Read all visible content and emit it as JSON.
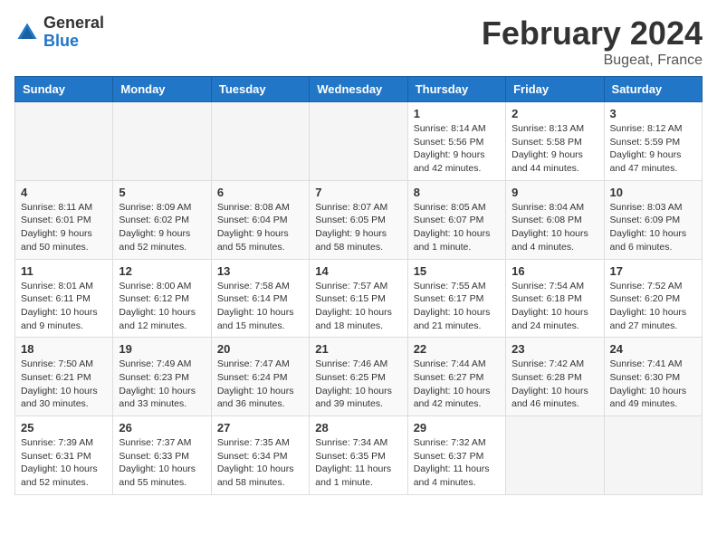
{
  "header": {
    "logo_general": "General",
    "logo_blue": "Blue",
    "month_title": "February 2024",
    "location": "Bugeat, France"
  },
  "weekdays": [
    "Sunday",
    "Monday",
    "Tuesday",
    "Wednesday",
    "Thursday",
    "Friday",
    "Saturday"
  ],
  "weeks": [
    [
      {
        "day": "",
        "info": ""
      },
      {
        "day": "",
        "info": ""
      },
      {
        "day": "",
        "info": ""
      },
      {
        "day": "",
        "info": ""
      },
      {
        "day": "1",
        "info": "Sunrise: 8:14 AM\nSunset: 5:56 PM\nDaylight: 9 hours\nand 42 minutes."
      },
      {
        "day": "2",
        "info": "Sunrise: 8:13 AM\nSunset: 5:58 PM\nDaylight: 9 hours\nand 44 minutes."
      },
      {
        "day": "3",
        "info": "Sunrise: 8:12 AM\nSunset: 5:59 PM\nDaylight: 9 hours\nand 47 minutes."
      }
    ],
    [
      {
        "day": "4",
        "info": "Sunrise: 8:11 AM\nSunset: 6:01 PM\nDaylight: 9 hours\nand 50 minutes."
      },
      {
        "day": "5",
        "info": "Sunrise: 8:09 AM\nSunset: 6:02 PM\nDaylight: 9 hours\nand 52 minutes."
      },
      {
        "day": "6",
        "info": "Sunrise: 8:08 AM\nSunset: 6:04 PM\nDaylight: 9 hours\nand 55 minutes."
      },
      {
        "day": "7",
        "info": "Sunrise: 8:07 AM\nSunset: 6:05 PM\nDaylight: 9 hours\nand 58 minutes."
      },
      {
        "day": "8",
        "info": "Sunrise: 8:05 AM\nSunset: 6:07 PM\nDaylight: 10 hours\nand 1 minute."
      },
      {
        "day": "9",
        "info": "Sunrise: 8:04 AM\nSunset: 6:08 PM\nDaylight: 10 hours\nand 4 minutes."
      },
      {
        "day": "10",
        "info": "Sunrise: 8:03 AM\nSunset: 6:09 PM\nDaylight: 10 hours\nand 6 minutes."
      }
    ],
    [
      {
        "day": "11",
        "info": "Sunrise: 8:01 AM\nSunset: 6:11 PM\nDaylight: 10 hours\nand 9 minutes."
      },
      {
        "day": "12",
        "info": "Sunrise: 8:00 AM\nSunset: 6:12 PM\nDaylight: 10 hours\nand 12 minutes."
      },
      {
        "day": "13",
        "info": "Sunrise: 7:58 AM\nSunset: 6:14 PM\nDaylight: 10 hours\nand 15 minutes."
      },
      {
        "day": "14",
        "info": "Sunrise: 7:57 AM\nSunset: 6:15 PM\nDaylight: 10 hours\nand 18 minutes."
      },
      {
        "day": "15",
        "info": "Sunrise: 7:55 AM\nSunset: 6:17 PM\nDaylight: 10 hours\nand 21 minutes."
      },
      {
        "day": "16",
        "info": "Sunrise: 7:54 AM\nSunset: 6:18 PM\nDaylight: 10 hours\nand 24 minutes."
      },
      {
        "day": "17",
        "info": "Sunrise: 7:52 AM\nSunset: 6:20 PM\nDaylight: 10 hours\nand 27 minutes."
      }
    ],
    [
      {
        "day": "18",
        "info": "Sunrise: 7:50 AM\nSunset: 6:21 PM\nDaylight: 10 hours\nand 30 minutes."
      },
      {
        "day": "19",
        "info": "Sunrise: 7:49 AM\nSunset: 6:23 PM\nDaylight: 10 hours\nand 33 minutes."
      },
      {
        "day": "20",
        "info": "Sunrise: 7:47 AM\nSunset: 6:24 PM\nDaylight: 10 hours\nand 36 minutes."
      },
      {
        "day": "21",
        "info": "Sunrise: 7:46 AM\nSunset: 6:25 PM\nDaylight: 10 hours\nand 39 minutes."
      },
      {
        "day": "22",
        "info": "Sunrise: 7:44 AM\nSunset: 6:27 PM\nDaylight: 10 hours\nand 42 minutes."
      },
      {
        "day": "23",
        "info": "Sunrise: 7:42 AM\nSunset: 6:28 PM\nDaylight: 10 hours\nand 46 minutes."
      },
      {
        "day": "24",
        "info": "Sunrise: 7:41 AM\nSunset: 6:30 PM\nDaylight: 10 hours\nand 49 minutes."
      }
    ],
    [
      {
        "day": "25",
        "info": "Sunrise: 7:39 AM\nSunset: 6:31 PM\nDaylight: 10 hours\nand 52 minutes."
      },
      {
        "day": "26",
        "info": "Sunrise: 7:37 AM\nSunset: 6:33 PM\nDaylight: 10 hours\nand 55 minutes."
      },
      {
        "day": "27",
        "info": "Sunrise: 7:35 AM\nSunset: 6:34 PM\nDaylight: 10 hours\nand 58 minutes."
      },
      {
        "day": "28",
        "info": "Sunrise: 7:34 AM\nSunset: 6:35 PM\nDaylight: 11 hours\nand 1 minute."
      },
      {
        "day": "29",
        "info": "Sunrise: 7:32 AM\nSunset: 6:37 PM\nDaylight: 11 hours\nand 4 minutes."
      },
      {
        "day": "",
        "info": ""
      },
      {
        "day": "",
        "info": ""
      }
    ]
  ]
}
